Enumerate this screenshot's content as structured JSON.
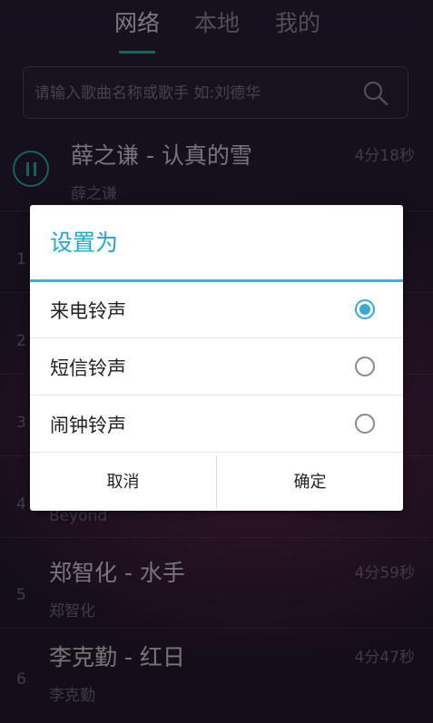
{
  "tabs": [
    {
      "label": "网络",
      "active": true
    },
    {
      "label": "本地",
      "active": false
    },
    {
      "label": "我的",
      "active": false
    }
  ],
  "search": {
    "placeholder": "请输入歌曲名称或歌手 如:刘德华",
    "value": ""
  },
  "songs": [
    {
      "index": "",
      "title": "薛之谦 - 认真的雪",
      "artist": "薛之谦",
      "duration": "4分18秒",
      "playing": true
    },
    {
      "index": "1",
      "title": "",
      "artist": "",
      "duration": "",
      "playing": false
    },
    {
      "index": "2",
      "title": "",
      "artist": "",
      "duration": "",
      "playing": false
    },
    {
      "index": "3",
      "title": "",
      "artist": "",
      "duration": "",
      "playing": false
    },
    {
      "index": "4",
      "title": "",
      "artist": "Beyond",
      "duration": "",
      "playing": false
    },
    {
      "index": "5",
      "title": "郑智化 - 水手",
      "artist": "郑智化",
      "duration": "4分59秒",
      "playing": false
    },
    {
      "index": "6",
      "title": "李克勤 - 红日",
      "artist": "李克勤",
      "duration": "4分47秒",
      "playing": false
    }
  ],
  "dialog": {
    "title": "设置为",
    "options": [
      {
        "label": "来电铃声",
        "checked": true
      },
      {
        "label": "短信铃声",
        "checked": false
      },
      {
        "label": "闹钟铃声",
        "checked": false
      }
    ],
    "cancel_label": "取消",
    "confirm_label": "确定"
  },
  "colors": {
    "accent": "#18b39a",
    "dialog_accent": "#3bb3d3"
  }
}
